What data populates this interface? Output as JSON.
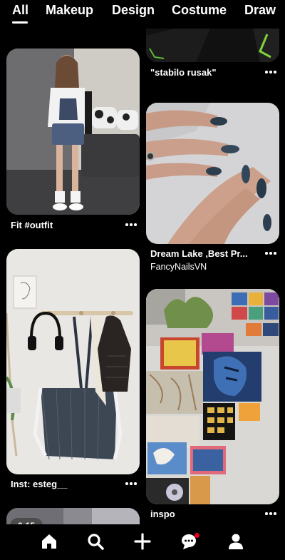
{
  "tabs": [
    "All",
    "Makeup",
    "Design",
    "Costume",
    "Draw"
  ],
  "pins": {
    "top_right": {
      "caption": "\"stabilo rusak\""
    },
    "outfit": {
      "caption": "Fit #outfit"
    },
    "nails": {
      "caption": "Dream Lake ,Best Pr...",
      "author": "FancyNailsVN"
    },
    "bags": {
      "caption": "Inst: esteg__"
    },
    "wall": {
      "caption": "inspo"
    },
    "video": {
      "duration": "0:15"
    }
  },
  "nav": {
    "items": [
      "home",
      "search",
      "create",
      "messages",
      "profile"
    ],
    "notification_color": "#e60023"
  }
}
